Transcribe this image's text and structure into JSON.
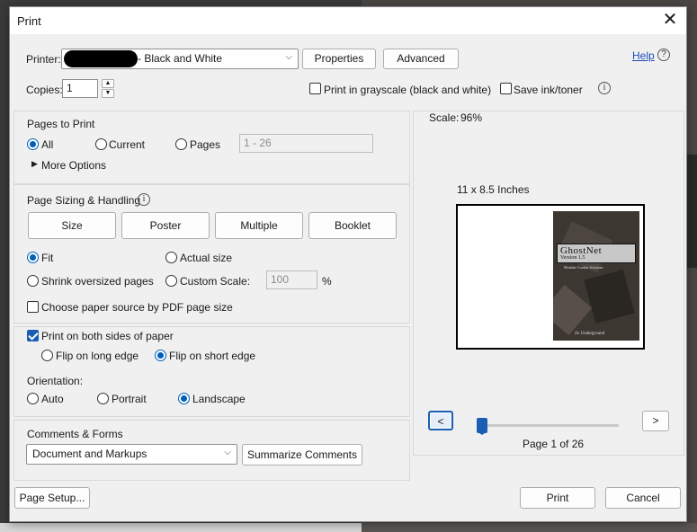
{
  "dialog": {
    "title": "Print"
  },
  "printer": {
    "label": "Printer:",
    "selected": "- Black and White",
    "properties_label": "Properties",
    "advanced_label": "Advanced",
    "help_label": "Help"
  },
  "copies": {
    "label": "Copies:",
    "value": "1"
  },
  "options": {
    "grayscale_label": "Print in grayscale (black and white)",
    "grayscale_checked": false,
    "save_ink_label": "Save ink/toner",
    "save_ink_checked": false
  },
  "pages_to_print": {
    "title": "Pages to Print",
    "all_label": "All",
    "current_label": "Current",
    "pages_label": "Pages",
    "pages_placeholder": "1 - 26",
    "selected": "All",
    "more_options_label": "More Options"
  },
  "page_sizing": {
    "title": "Page Sizing & Handling",
    "tabs": [
      "Size",
      "Poster",
      "Multiple",
      "Booklet"
    ],
    "fit_label": "Fit",
    "actual_label": "Actual size",
    "shrink_label": "Shrink oversized pages",
    "custom_label": "Custom Scale:",
    "custom_value": "100",
    "percent": "%",
    "selected": "Fit",
    "paper_source_label": "Choose paper source by PDF page size",
    "paper_source_checked": false
  },
  "duplex": {
    "both_sides_label": "Print on both sides of paper",
    "both_sides_checked": true,
    "long_edge_label": "Flip on long edge",
    "short_edge_label": "Flip on short edge",
    "selected": "short"
  },
  "orientation": {
    "label": "Orientation:",
    "auto_label": "Auto",
    "portrait_label": "Portrait",
    "landscape_label": "Landscape",
    "selected": "Landscape"
  },
  "comments": {
    "title": "Comments & Forms",
    "selected": "Document and Markups",
    "summarize_label": "Summarize Comments"
  },
  "preview": {
    "scale_label": "Scale:",
    "scale_value": "96%",
    "paper_size": "11 x 8.5 Inches",
    "cover_title": "GhostNet",
    "cover_version": "Version 1.5",
    "cover_subtitle": "Modular Combat Solutions",
    "cover_author": "Ze Underground",
    "prev_label": "<",
    "next_label": ">",
    "page_status": "Page 1 of 26",
    "page_current": 1,
    "page_total": 26
  },
  "footer": {
    "page_setup_label": "Page Setup...",
    "print_label": "Print",
    "cancel_label": "Cancel"
  },
  "icons": {
    "close": "close-icon",
    "help": "help-circle-icon",
    "info": "info-icon",
    "chevron": "chevron-down-icon"
  },
  "colors": {
    "accent": "#1a5fb4",
    "dialog_bg": "#f0f0f0"
  }
}
